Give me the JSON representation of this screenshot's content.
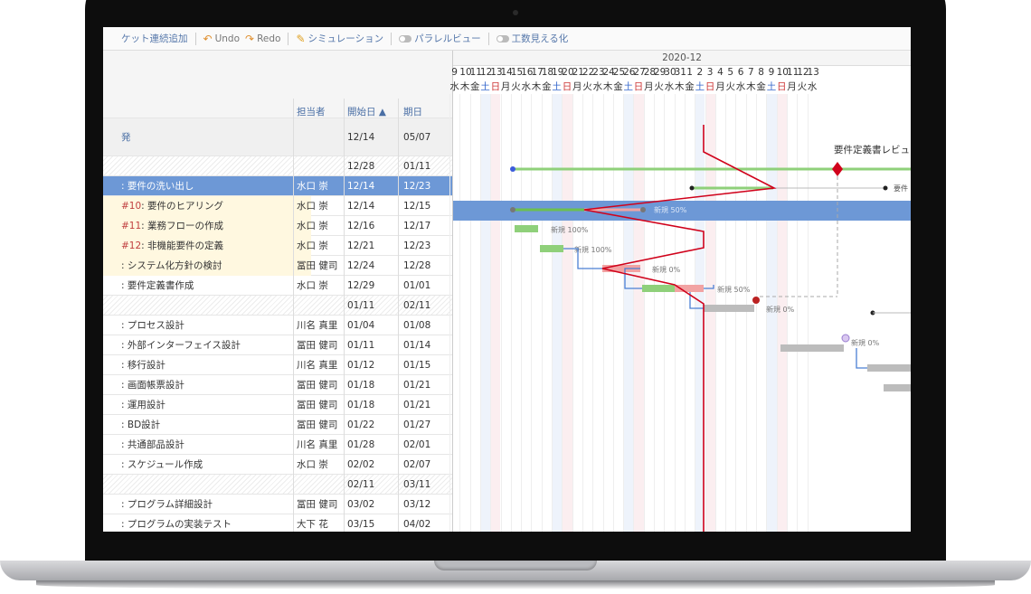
{
  "toolbar": {
    "items": [
      {
        "label": "ケット連続追加",
        "icon": "ticket-add-icon"
      },
      {
        "label": "Undo",
        "icon": "undo-icon"
      },
      {
        "label": "Redo",
        "icon": "redo-icon"
      },
      {
        "label": "シミュレーション",
        "icon": "pencil-icon"
      },
      {
        "label": "パラレルビュー",
        "icon": "toggle-icon"
      },
      {
        "label": "工数見える化",
        "icon": "toggle-icon"
      }
    ]
  },
  "columns": {
    "owner": "担当者",
    "start": "開始日 ▲",
    "end": "期日"
  },
  "month_label": "2020-12",
  "days": [
    "9",
    "10",
    "11",
    "12",
    "13",
    "14",
    "15",
    "16",
    "17",
    "18",
    "19",
    "20",
    "21",
    "22",
    "23",
    "24",
    "25",
    "26",
    "27",
    "28",
    "29",
    "30",
    "31",
    "1",
    "2",
    "3",
    "4",
    "5",
    "6",
    "7",
    "8",
    "9",
    "10",
    "11",
    "12",
    "13"
  ],
  "dows": [
    "水",
    "木",
    "金",
    "土",
    "日",
    "月",
    "火",
    "水",
    "木",
    "金",
    "土",
    "日",
    "月",
    "火",
    "水",
    "木",
    "金",
    "土",
    "日",
    "月",
    "火",
    "水",
    "木",
    "金",
    "土",
    "日",
    "月",
    "火",
    "水",
    "木",
    "金",
    "土",
    "日",
    "月",
    "火",
    "水"
  ],
  "rows": [
    {
      "task": "",
      "ticket": "",
      "owner": "",
      "start": "",
      "end": "",
      "style": "blank"
    },
    {
      "task": "発",
      "ticket": "",
      "owner": "",
      "start": "12/14",
      "end": "05/07",
      "style": "gray-tall"
    },
    {
      "task": "",
      "ticket": "",
      "owner": "",
      "start": "12/28",
      "end": "01/11",
      "style": "hatched"
    },
    {
      "task": ": 要件の洗い出し",
      "ticket": "",
      "owner": "水口 崇",
      "start": "12/14",
      "end": "12/23",
      "style": "selected"
    },
    {
      "task": ": 要件のヒアリング",
      "ticket": "#10",
      "owner": "水口 崇",
      "start": "12/14",
      "end": "12/15",
      "style": "yellow"
    },
    {
      "task": ": 業務フローの作成",
      "ticket": "#11",
      "owner": "水口 崇",
      "start": "12/16",
      "end": "12/17",
      "style": "yellow"
    },
    {
      "task": ": 非機能要件の定義",
      "ticket": "#12",
      "owner": "水口 崇",
      "start": "12/21",
      "end": "12/23",
      "style": "yellow"
    },
    {
      "task": ": システム化方針の検討",
      "ticket": "",
      "owner": "冨田 健司",
      "start": "12/24",
      "end": "12/28",
      "style": "yellow"
    },
    {
      "task": ": 要件定義書作成",
      "ticket": "",
      "owner": "水口 崇",
      "start": "12/29",
      "end": "01/01",
      "style": "plain"
    },
    {
      "task": "",
      "ticket": "",
      "owner": "",
      "start": "01/11",
      "end": "02/11",
      "style": "hatched"
    },
    {
      "task": ": プロセス設計",
      "ticket": "",
      "owner": "川名 真里",
      "start": "01/04",
      "end": "01/08",
      "style": "plain"
    },
    {
      "task": ": 外部インターフェイス設計",
      "ticket": "",
      "owner": "冨田 健司",
      "start": "01/11",
      "end": "01/14",
      "style": "plain"
    },
    {
      "task": ": 移行設計",
      "ticket": "",
      "owner": "川名 真里",
      "start": "01/12",
      "end": "01/15",
      "style": "plain"
    },
    {
      "task": ": 画面帳票設計",
      "ticket": "",
      "owner": "冨田 健司",
      "start": "01/18",
      "end": "01/21",
      "style": "plain"
    },
    {
      "task": ": 運用設計",
      "ticket": "",
      "owner": "冨田 健司",
      "start": "01/18",
      "end": "01/21",
      "style": "plain"
    },
    {
      "task": ": BD設計",
      "ticket": "",
      "owner": "冨田 健司",
      "start": "01/22",
      "end": "01/27",
      "style": "plain"
    },
    {
      "task": ": 共通部品設計",
      "ticket": "",
      "owner": "川名 真里",
      "start": "01/28",
      "end": "02/01",
      "style": "plain"
    },
    {
      "task": ": スケジュール作成",
      "ticket": "",
      "owner": "水口 崇",
      "start": "02/02",
      "end": "02/07",
      "style": "plain"
    },
    {
      "task": "",
      "ticket": "",
      "owner": "",
      "start": "02/11",
      "end": "03/11",
      "style": "hatched"
    },
    {
      "task": ": プログラム詳細設計",
      "ticket": "",
      "owner": "冨田 健司",
      "start": "03/02",
      "end": "03/12",
      "style": "plain"
    },
    {
      "task": ": プログラムの実装テスト",
      "ticket": "",
      "owner": "大下 花",
      "start": "03/15",
      "end": "04/02",
      "style": "plain"
    }
  ],
  "gantt_labels": {
    "milestone": "要件定義書レビュー",
    "milestone_short": "要件",
    "progress": [
      "新規 50%",
      "新規 100%",
      "新規 100%",
      "新規 0%",
      "新規 50%",
      "新規 0%",
      "新規 0%"
    ]
  },
  "colors": {
    "accent": "#4a6fa5",
    "selected": "#6d98d6",
    "today_line": "#d0021b",
    "done_bar": "#8fd07a",
    "late_bar": "#f2a3a3",
    "todo_bar": "#bcbcbc"
  }
}
